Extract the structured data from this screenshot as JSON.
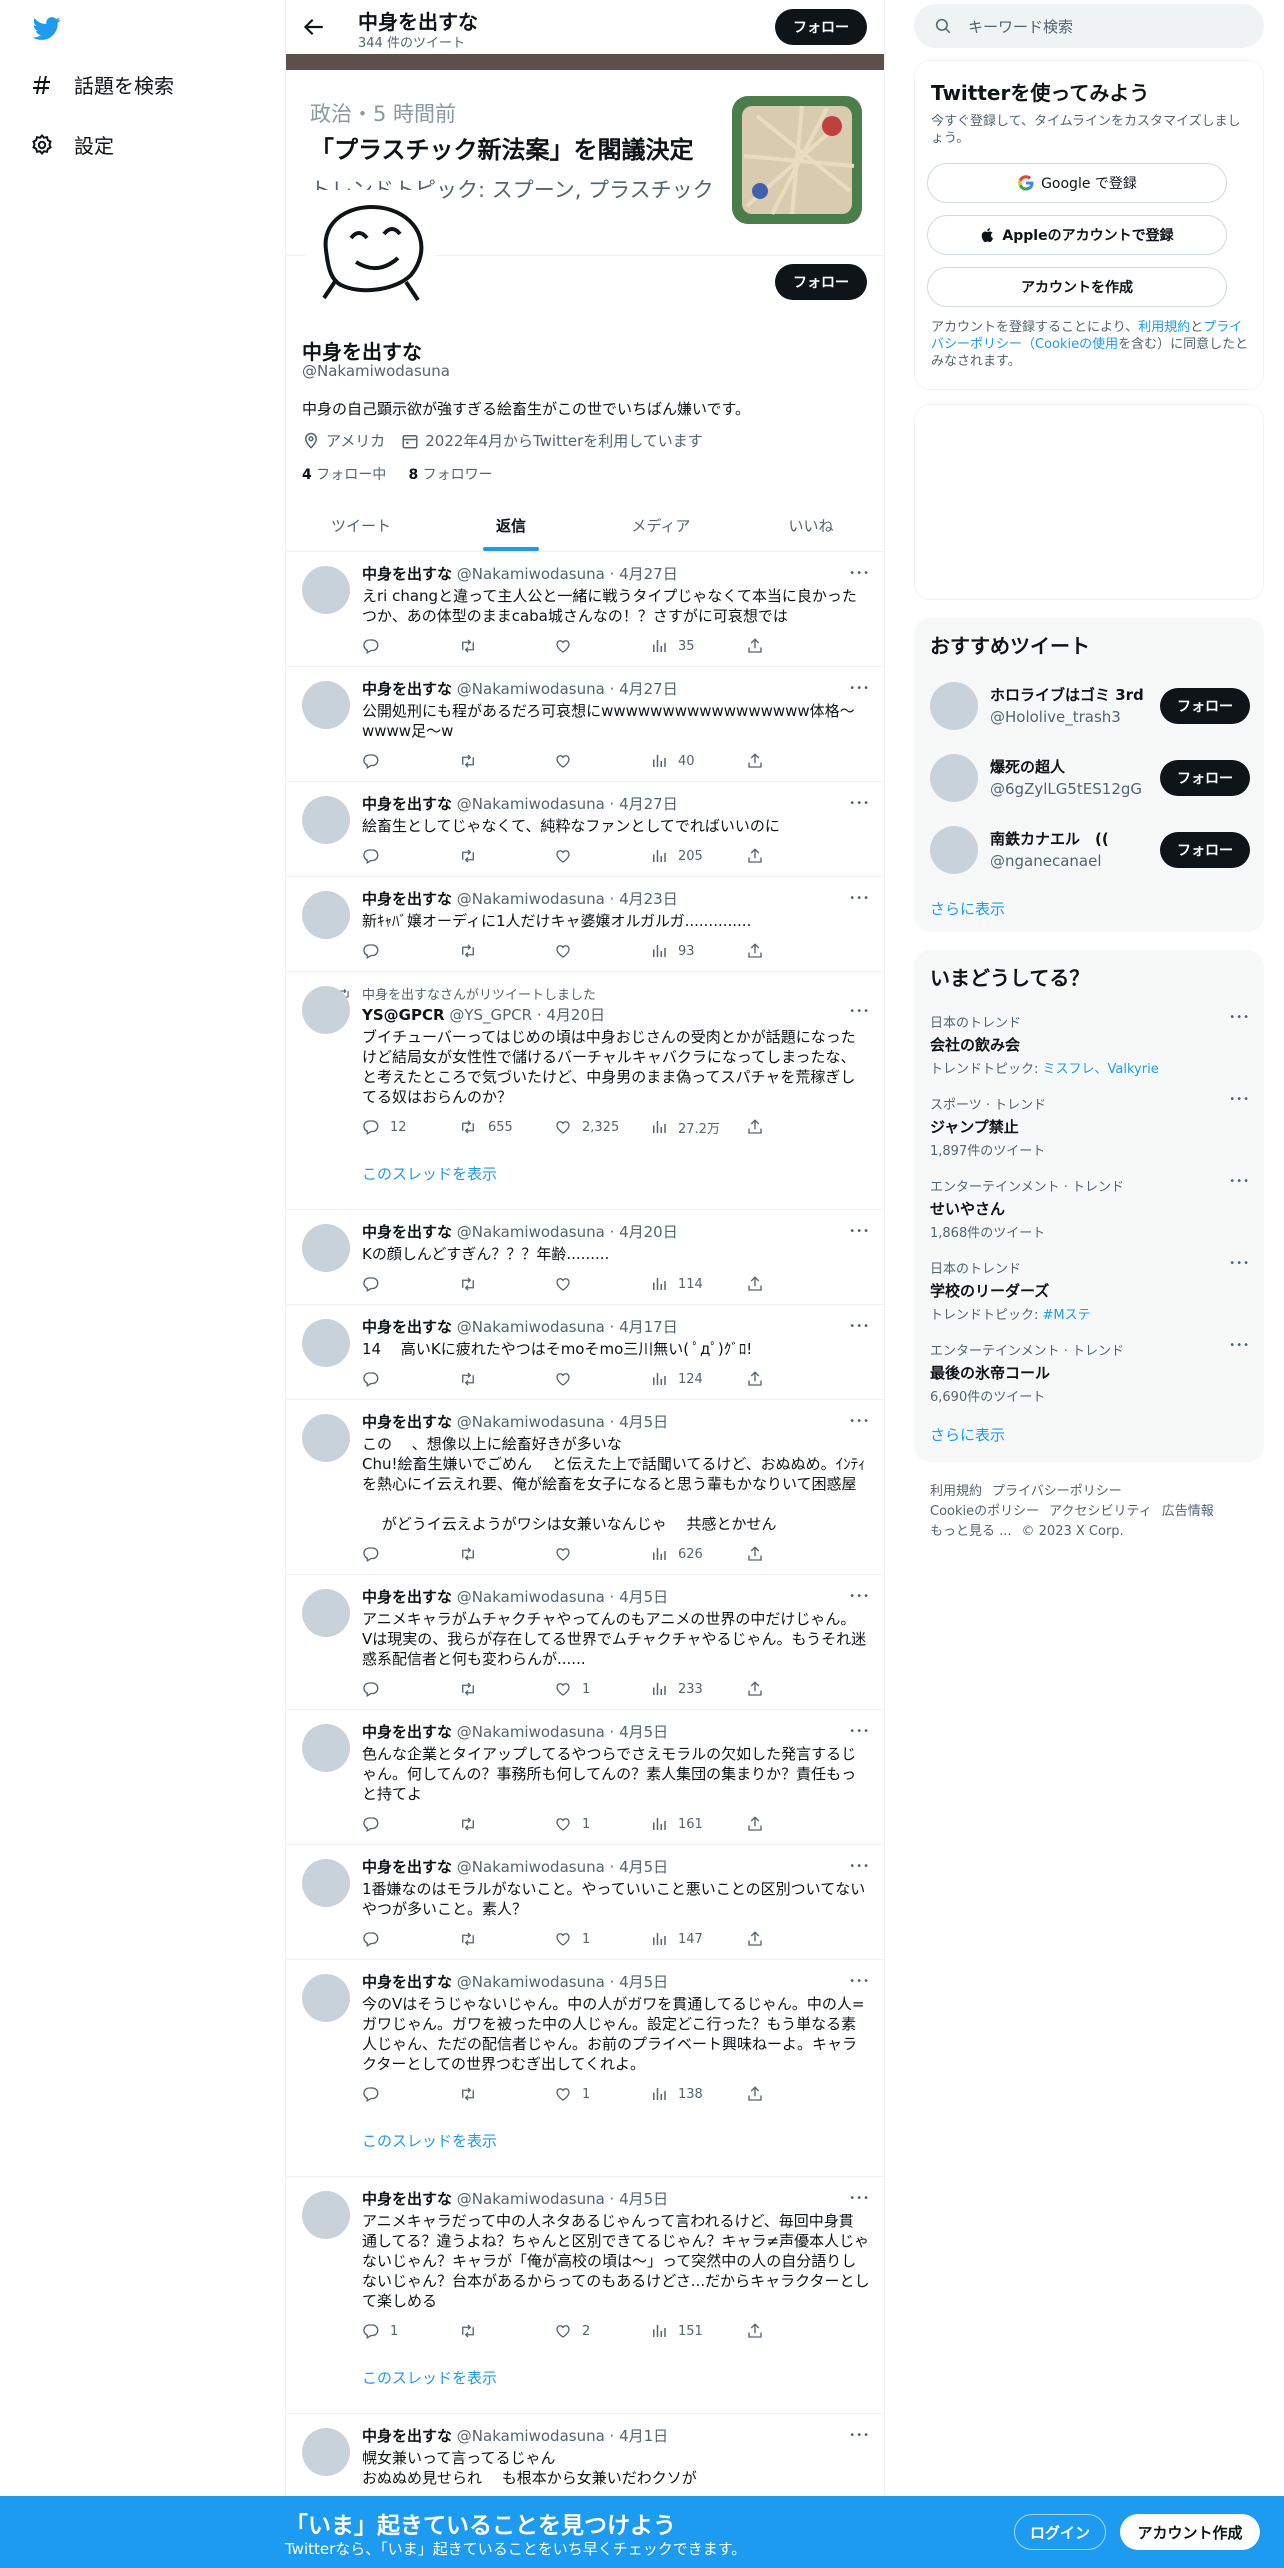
{
  "nav": {
    "explore_label": "話題を検索",
    "settings_label": "設定"
  },
  "topbar": {
    "name": "中身を出すな",
    "tweet_count": "344 件のツイート",
    "follow_label": "フォロー"
  },
  "news_card": {
    "meta": "政治・5 時間前",
    "title": "「プラスチック新法案」を閣議決定",
    "topic": "トレンドトピック: スプーン, プラスチック"
  },
  "profile": {
    "follow_label": "フォロー",
    "name": "中身を出すな",
    "handle": "@Nakamiwodasuna",
    "bio": "中身の自己顕示欲が強すぎる絵畜生がこの世でいちばん嫌いです。",
    "location": "アメリカ",
    "joined": "2022年4月からTwitterを利用しています",
    "following_count": "4",
    "following_label": "フォロー中",
    "followers_count": "8",
    "followers_label": "フォロワー"
  },
  "tabs": [
    {
      "label": "ツイート",
      "active": false
    },
    {
      "label": "返信",
      "active": true
    },
    {
      "label": "メディア",
      "active": false
    },
    {
      "label": "いいね",
      "active": false
    }
  ],
  "tweets": [
    {
      "name": "中身を出すな",
      "meta": "@Nakamiwodasuna · 4月27日",
      "text": "えri changと違って主人公と一緒に戦うタイプじゃなくて本当に良かった\nつか、あの体型のままcaba城さんなの！？さすがに可哀想では",
      "replies": "",
      "retweets": "",
      "likes": "",
      "views": "35"
    },
    {
      "name": "中身を出すな",
      "meta": "@Nakamiwodasuna · 4月27日",
      "text": "公開処刑にも程があるだろ可哀想にwwwwwwwwwwwwwwwww体格〜\nwwww足〜w",
      "replies": "",
      "retweets": "",
      "likes": "",
      "views": "40"
    },
    {
      "name": "中身を出すな",
      "meta": "@Nakamiwodasuna · 4月27日",
      "text": "絵畜生としてじゃなくて、純粋なファンとしてでればいいのに",
      "replies": "",
      "retweets": "",
      "likes": "",
      "views": "205"
    },
    {
      "name": "中身を出すな",
      "meta": "@Nakamiwodasuna · 4月23日",
      "text": "新ｷｬﾊﾞ嬢オーディに1人だけキャ婆嬢オルガルガ..............",
      "replies": "",
      "retweets": "",
      "likes": "",
      "views": "93"
    },
    {
      "retweet_label": "中身を出すなさんがリツイートしました",
      "name": "YS@GPCR",
      "meta": "@YS_GPCR · 4月20日",
      "text": "ブイチューバーってはじめの頃は中身おじさんの受肉とかが話題になった\nけど結局女が女性性で儲けるバーチャルキャバクラになってしまったな、\nと考えたところで気づいたけど、中身男のまま偽ってスパチャを荒稼ぎし\nてる奴はおらんのか？",
      "replies": "12",
      "retweets": "655",
      "likes": "2,325",
      "views": "27.2万",
      "thread": "このスレッドを表示"
    },
    {
      "name": "中身を出すな",
      "meta": "@Nakamiwodasuna · 4月20日",
      "text": "Kの顔しんどすぎん？？？年齢.........",
      "replies": "",
      "retweets": "",
      "likes": "",
      "views": "114"
    },
    {
      "name": "中身を出すな",
      "meta": "@Nakamiwodasuna · 4月17日",
      "text": "14　 高いKに疲れたやつはそmoそmo三川無い( ﾟдﾟ)ｸﾞﾛ!",
      "replies": "",
      "retweets": "",
      "likes": "",
      "views": "124"
    },
    {
      "name": "中身を出すな",
      "meta": "@Nakamiwodasuna · 4月5日",
      "text": "この　 、想像以上に絵畜好きが多いな\nChu!絵畜生嫌いでごめん　 と伝えた上で話聞いてるけど、おぬぬめ。ｲﾝﾃｨ\nを熱心にイ云えれ要、俺が絵畜を女子になると思う輩もかなりいて困惑屋\n\n　 がどうイ云えようがワシは女兼いなんじゃ　 共感とかせん",
      "replies": "",
      "retweets": "",
      "likes": "",
      "views": "626"
    },
    {
      "name": "中身を出すな",
      "meta": "@Nakamiwodasuna · 4月5日",
      "text": "アニメキャラがムチャクチャやってんのもアニメの世界の中だけじゃん。\nVは現実の、我らが存在してる世界でムチャクチャやるじゃん。もうそれ迷\n惑系配信者と何も変わらんが......",
      "replies": "",
      "retweets": "",
      "likes": "1",
      "views": "233"
    },
    {
      "name": "中身を出すな",
      "meta": "@Nakamiwodasuna · 4月5日",
      "text": "色んな企業とタイアップしてるやつらでさえモラルの欠如した発言するじ\nゃん。何してんの？事務所も何してんの？素人集団の集まりか？責任もっ\nと持てよ",
      "replies": "",
      "retweets": "",
      "likes": "1",
      "views": "161"
    },
    {
      "name": "中身を出すな",
      "meta": "@Nakamiwodasuna · 4月5日",
      "text": "1番嫌なのはモラルがないこと。やっていいこと悪いことの区別ついてない\nやつが多いこと。素人？",
      "replies": "",
      "retweets": "",
      "likes": "1",
      "views": "147"
    },
    {
      "name": "中身を出すな",
      "meta": "@Nakamiwodasuna · 4月5日",
      "text": "今のVはそうじゃないじゃん。中の人がガワを貫通してるじゃん。中の人=\nガワじゃん。ガワを被った中の人じゃん。設定どこ行った？もう単なる素\n人じゃん、ただの配信者じゃん。お前のプライベート興味ねーよ。キャラ\nクターとしての世界つむぎ出してくれよ。",
      "replies": "",
      "retweets": "",
      "likes": "1",
      "views": "138",
      "thread": "このスレッドを表示"
    },
    {
      "name": "中身を出すな",
      "meta": "@Nakamiwodasuna · 4月5日",
      "text": "アニメキャラだって中の人ネタあるじゃんって言われるけど、毎回中身貫\n通してる？違うよね？ちゃんと区別できてるじゃん？キャラ≠声優本人じゃ\nないじゃん？キャラが「俺が高校の頃は〜」って突然中の人の自分語りし\nないじゃん？台本があるからってのもあるけどさ...だからキャラクターとし\nて楽しめる",
      "replies": "1",
      "retweets": "",
      "likes": "2",
      "views": "151",
      "thread": "このスレッドを表示"
    },
    {
      "name": "中身を出すな",
      "meta": "@Nakamiwodasuna · 4月1日",
      "text": "幌女兼いって言ってるじゃん\nおぬぬめ見せられ　 も根本から女兼いだわクソが",
      "replies": "",
      "retweets": "",
      "likes": "",
      "views": ""
    }
  ],
  "search": {
    "placeholder": "キーワード検索"
  },
  "signup": {
    "title": "Twitterを使ってみよう",
    "subtitle": "今すぐ登録して、タイムラインをカスタマイズしましょう。",
    "google_label": "Google で登録",
    "apple_label": "Appleのアカウントで登録",
    "create_label": "アカウントを作成",
    "legal_prefix": "アカウントを登録することにより、",
    "legal_terms": "利用規約",
    "legal_and": "と",
    "legal_privacy": "プライバシーポリシー",
    "legal_cookie": "（Cookieの使用",
    "legal_suffix": "を含む）に同意したとみなされます。"
  },
  "who_to_follow": {
    "title": "おすすめツイート",
    "users": [
      {
        "name": "ホロライブはゴミ 3rd",
        "handle": "@Hololive_trash3",
        "follow_label": "フォロー"
      },
      {
        "name": "爆死の超人",
        "handle": "@6gZylLG5tES12gG",
        "follow_label": "フォロー"
      },
      {
        "name": "南鉄カナエル　((",
        "handle": "@nganecanael",
        "follow_label": "フォロー"
      }
    ],
    "more_label": "さらに表示"
  },
  "trends": {
    "title": "いまどうしてる？",
    "items": [
      {
        "context": "日本のトレンド",
        "name": "会社の飲み会",
        "sub_prefix": "トレンドトピック: ",
        "sub_link": "ミスフレ、Valkyrie",
        "sub": ""
      },
      {
        "context": "スポーツ · トレンド",
        "name": "ジャンプ禁止",
        "sub_prefix": "",
        "sub_link": "",
        "sub": "1,897件のツイート"
      },
      {
        "context": "エンターテインメント · トレンド",
        "name": "せいやさん",
        "sub_prefix": "",
        "sub_link": "",
        "sub": "1,868件のツイート"
      },
      {
        "context": "日本のトレンド",
        "name": "学校のリーダーズ",
        "sub_prefix": "トレンドトピック: ",
        "sub_link": "#Mステ",
        "sub": ""
      },
      {
        "context": "エンターテインメント · トレンド",
        "name": "最後の氷帝コール",
        "sub_prefix": "",
        "sub_link": "",
        "sub": "6,690件のツイート"
      }
    ],
    "more_label": "さらに表示"
  },
  "footer": {
    "terms": "利用規約",
    "privacy": "プライバシーポリシー",
    "cookie": "Cookieのポリシー",
    "accessibility": "アクセシビリティ",
    "ads": "広告情報",
    "more": "もっと見る ...",
    "copyright": "© 2023 X Corp."
  },
  "bottom_bar": {
    "title": "「いま」起きていることを見つけよう",
    "subtitle": "Twitterなら、「いま」起きていることをいち早くチェックできます。",
    "login_label": "ログイン",
    "signup_label": "アカウント作成"
  },
  "colors": {
    "accent": "#1d9bf0",
    "text": "#0f1419",
    "muted": "#536471"
  }
}
